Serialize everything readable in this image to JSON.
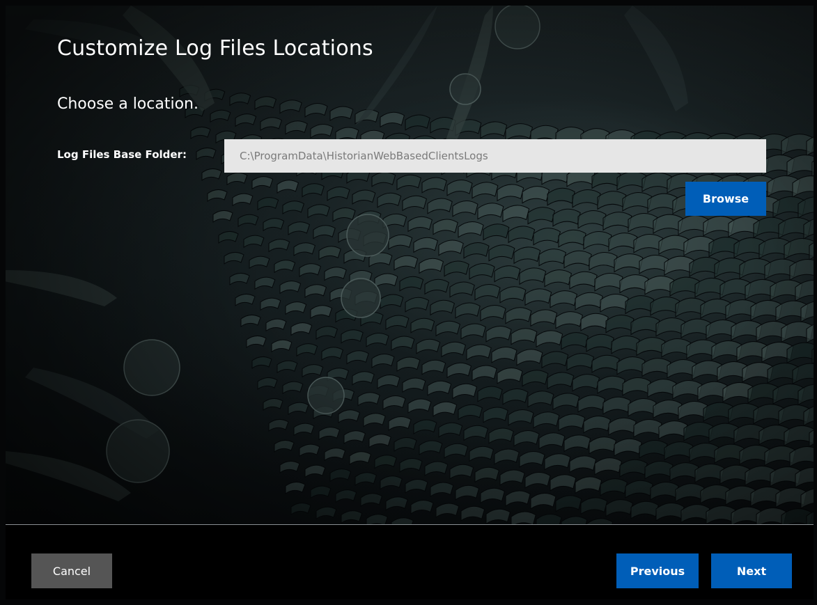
{
  "page": {
    "title": "Customize Log Files Locations",
    "subtitle": "Choose a location."
  },
  "form": {
    "log_folder_label": "Log Files Base Folder:",
    "log_folder_value": "C:\\ProgramData\\HistorianWebBasedClientsLogs",
    "browse_label": "Browse"
  },
  "footer": {
    "cancel_label": "Cancel",
    "previous_label": "Previous",
    "next_label": "Next"
  },
  "colors": {
    "primary_button": "#005eb8",
    "secondary_button": "#555555",
    "input_background": "#e6e6e6",
    "background": "#050607"
  },
  "icons": {
    "background": "turbine-blades-background-image"
  }
}
